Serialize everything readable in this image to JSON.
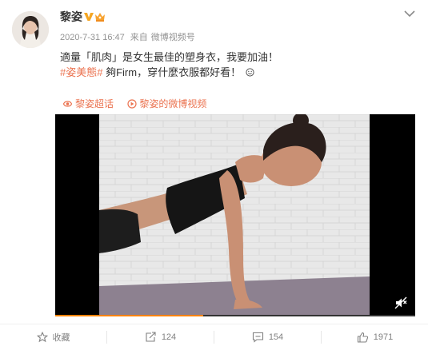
{
  "post": {
    "author": "黎姿",
    "date": "2020-7-31 16:47",
    "source_prefix": "来自",
    "source": "微博视频号",
    "text_line1": "適量「肌肉」是女生最佳的塑身衣，我要加油！",
    "topic": "#姿美態#",
    "text_line2_rest": " 夠Firm，穿什麼衣服都好看！"
  },
  "links": {
    "supertopic": "黎姿超话",
    "video_account": "黎姿的微博视频"
  },
  "video": {
    "progress": 0.41
  },
  "actions": {
    "favorite_label": "收藏",
    "repost_count": "124",
    "comment_count": "154",
    "like_count": "1971"
  },
  "icons": {
    "verified": "verified-v-icon",
    "crown": "member-crown-icon",
    "menu": "chevron-down-icon",
    "emoji": "smile-emoji-icon",
    "supertopic": "supertopic-icon",
    "video": "video-play-icon",
    "mute": "mute-icon",
    "favorite": "star-icon",
    "repost": "repost-icon",
    "comment": "comment-icon",
    "like": "thumbs-up-icon"
  },
  "colors": {
    "accent": "#eb7350",
    "progress": "#ff8200",
    "verified": "#f5a623"
  }
}
